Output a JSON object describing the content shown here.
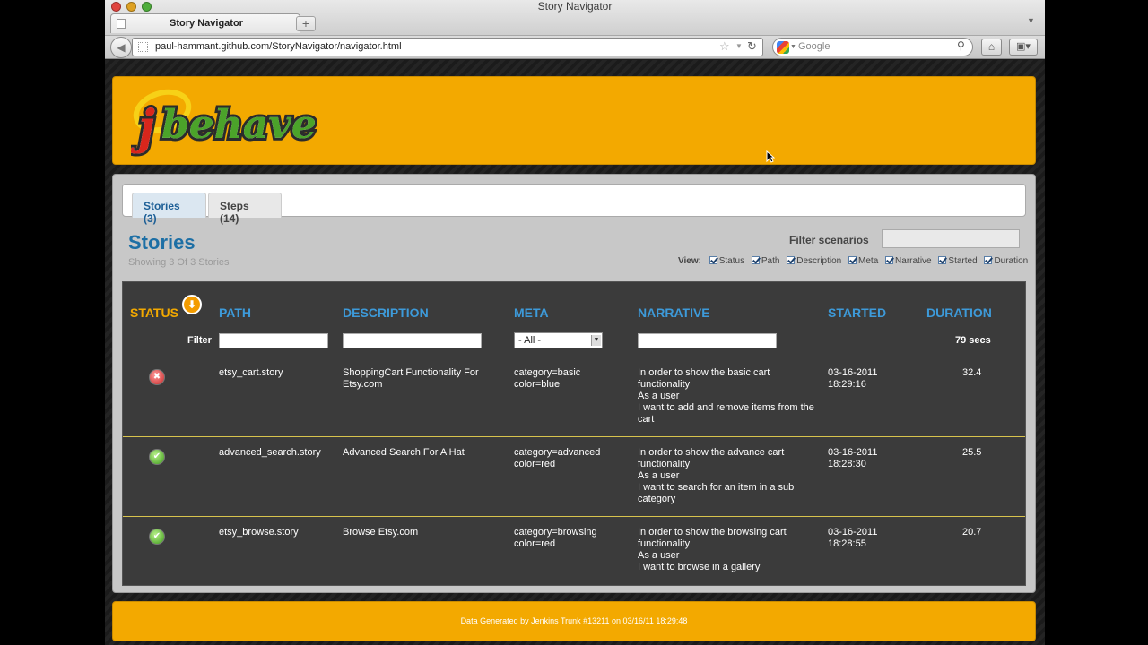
{
  "window": {
    "title": "Story Navigator"
  },
  "browser": {
    "tab_title": "Story Navigator",
    "new_tab_label": "+",
    "url": "paul-hammant.github.com/StoryNavigator/navigator.html",
    "search_placeholder": "Google"
  },
  "header": {
    "logo_text": "jbehave",
    "brand_color": "#f3a900"
  },
  "tabs": [
    {
      "label": "Stories (3)",
      "active": true
    },
    {
      "label": "Steps (14)",
      "active": false
    }
  ],
  "stories": {
    "title": "Stories",
    "subtitle": "Showing 3 Of 3 Stories",
    "filter_label": "Filter scenarios",
    "view_label": "View:",
    "view_options": [
      "Status",
      "Path",
      "Description",
      "Meta",
      "Narrative",
      "Started",
      "Duration"
    ]
  },
  "table": {
    "headers": {
      "status": "STATUS",
      "path": "PATH",
      "description": "DESCRIPTION",
      "meta": "META",
      "narrative": "NARRATIVE",
      "started": "STARTED",
      "duration": "DURATION"
    },
    "filter_label": "Filter",
    "meta_select_value": "- All -",
    "total_duration": "79 secs",
    "rows": [
      {
        "status": "failed",
        "path": "etsy_cart.story",
        "description": "ShoppingCart Functionality For Etsy.com",
        "meta": [
          "category=basic",
          "color=blue"
        ],
        "narrative": [
          "In order to show the basic cart functionality",
          "As a user",
          "I want to add and remove items from the cart"
        ],
        "started": [
          "03-16-2011",
          "18:29:16"
        ],
        "duration": "32.4"
      },
      {
        "status": "passed",
        "path": "advanced_search.story",
        "description": "Advanced Search For A Hat",
        "meta": [
          "category=advanced",
          "color=red"
        ],
        "narrative": [
          "In order to show the advance cart functionality",
          "As a user",
          "I want to search for an item in a sub category"
        ],
        "started": [
          "03-16-2011",
          "18:28:30"
        ],
        "duration": "25.5"
      },
      {
        "status": "passed",
        "path": "etsy_browse.story",
        "description": "Browse Etsy.com",
        "meta": [
          "category=browsing",
          "color=red"
        ],
        "narrative": [
          "In order to show the browsing cart functionality",
          "As a user",
          "I want to browse in a gallery"
        ],
        "started": [
          "03-16-2011",
          "18:28:55"
        ],
        "duration": "20.7"
      }
    ]
  },
  "footer": {
    "text": "Data Generated by Jenkins Trunk #13211 on 03/16/11 18:29:48"
  }
}
